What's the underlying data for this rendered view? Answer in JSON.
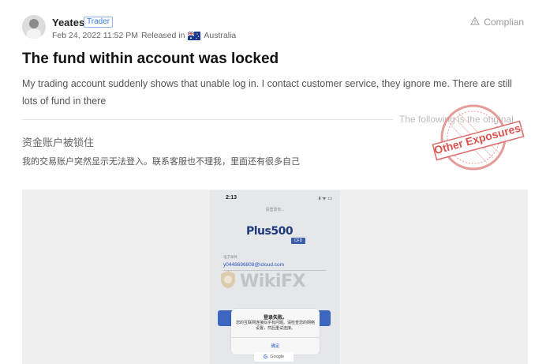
{
  "author": {
    "name": "Yeates",
    "role_badge": "Trader",
    "date": "Feb 24, 2022 11:52 PM",
    "released_in": "Released in",
    "country": "Australia"
  },
  "complain_label": "Complian",
  "post": {
    "title": "The fund within account was locked",
    "body": "My trading account suddenly shows that unable log in. I contact customer service, they ignore me. There are still lots of fund in there"
  },
  "original_divider": "The following is the original",
  "stamp_text": "Other Exposures",
  "original": {
    "title": "资金账户被锁住",
    "body": "我的交易账户突然显示无法登入。联系客服也不理我，里面还有很多自己"
  },
  "screenshot": {
    "status_time": "2:13",
    "status_icons": "ıl ᯤ ▭",
    "top_label": "请登录你...",
    "logo": "Plus500",
    "logo_tag": "CFD",
    "email_label": "电子邮件",
    "email": "y0448696808@icloud.com",
    "watermark": "WikiFX",
    "dialog": {
      "title": "登录失败。",
      "message": "您的互联网连接似乎有问题。请检查您的网络设置，然后重试连接。",
      "button": "确定"
    },
    "google_label": "Google"
  },
  "colors": {
    "badge": "#3b7dd8",
    "stamp": "#d9534f",
    "email": "#2a55b8"
  }
}
